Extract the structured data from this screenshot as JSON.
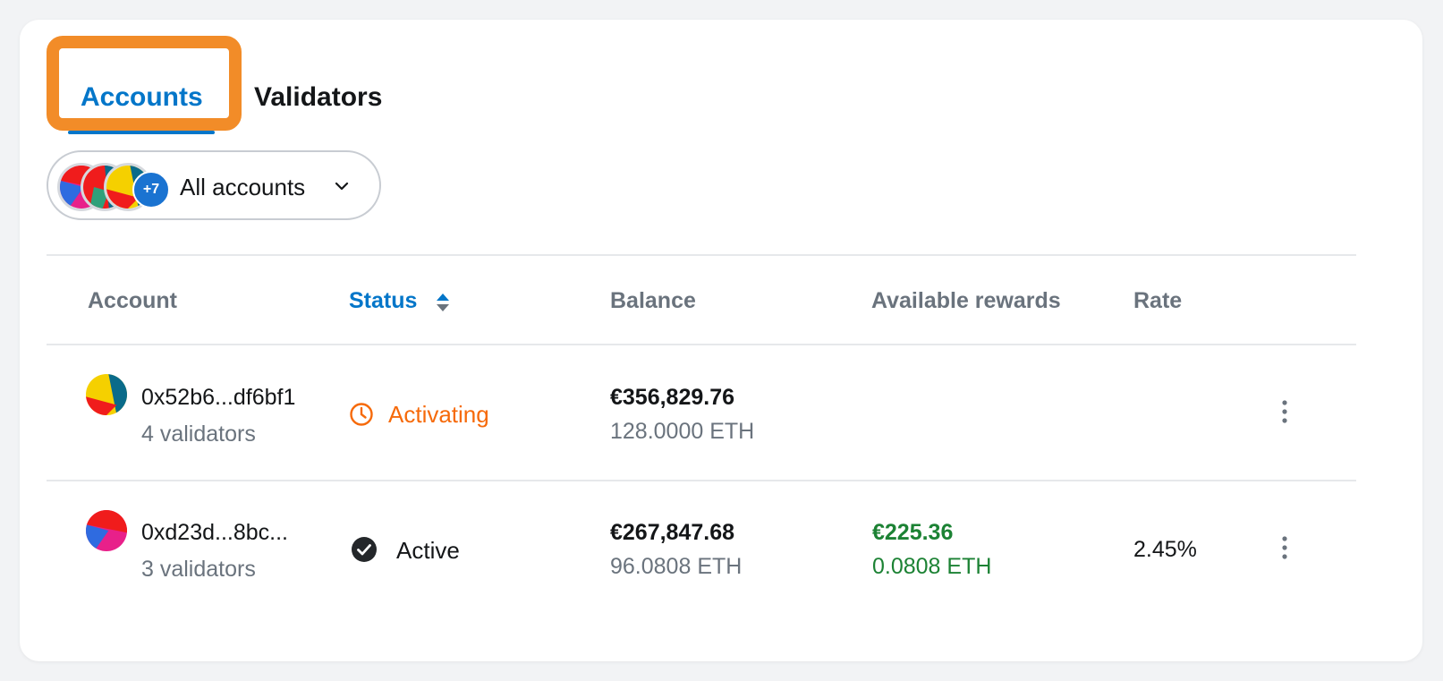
{
  "tabs": {
    "accounts": "Accounts",
    "validators": "Validators"
  },
  "filter": {
    "label": "All accounts",
    "more_count": "+7"
  },
  "table": {
    "headers": {
      "account": "Account",
      "status": "Status",
      "balance": "Balance",
      "rewards": "Available rewards",
      "rate": "Rate"
    },
    "rows": [
      {
        "address": "0x52b6...df6bf1",
        "validators": "4 validators",
        "status": "Activating",
        "balance_fiat": "€356,829.76",
        "balance_eth": "128.0000 ETH",
        "rewards_fiat": "",
        "rewards_eth": "",
        "rate": ""
      },
      {
        "address": "0xd23d...8bc...",
        "validators": "3 validators",
        "status": "Active",
        "balance_fiat": "€267,847.68",
        "balance_eth": "96.0808 ETH",
        "rewards_fiat": "€225.36",
        "rewards_eth": "0.0808 ETH",
        "rate": "2.45%"
      }
    ]
  },
  "colors": {
    "accent": "#0376c9",
    "highlight": "#f28c28",
    "activating": "#f66a0a",
    "positive": "#1c8234"
  },
  "icons": [
    "chevron-down-icon",
    "sort-icon",
    "clock-icon",
    "check-circle-icon",
    "kebab-menu-icon"
  ]
}
